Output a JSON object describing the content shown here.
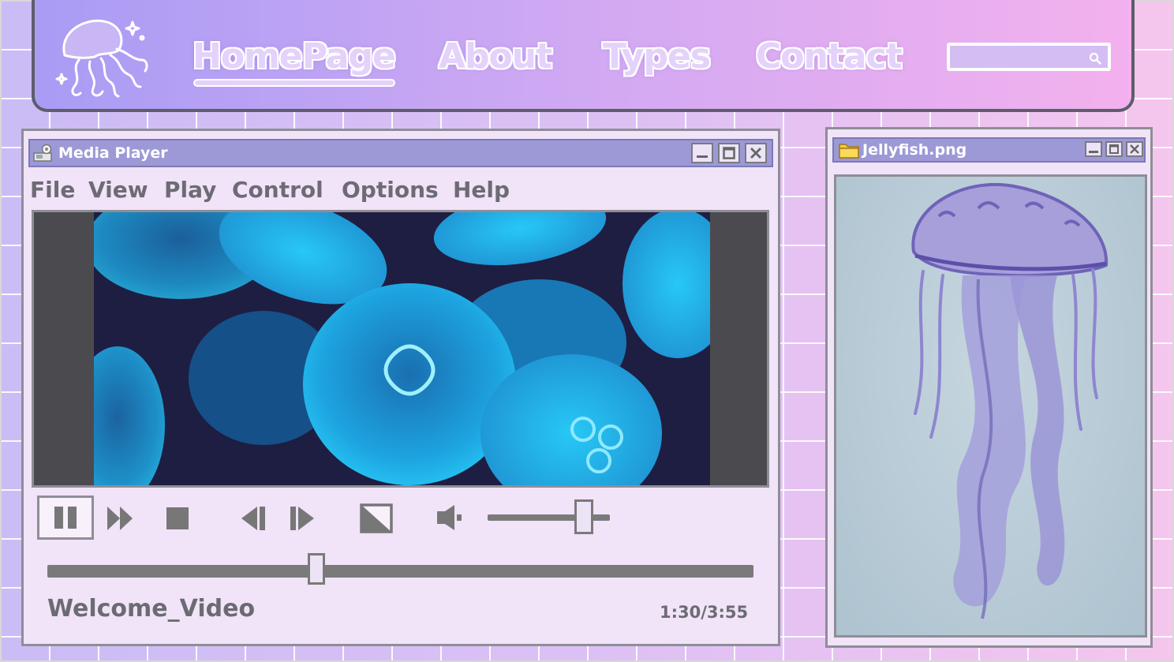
{
  "nav": {
    "links": [
      "HomePage",
      "About",
      "Types",
      "Contact"
    ],
    "active": "HomePage",
    "search_placeholder": "",
    "colors": {
      "bar_start": "#a99cf4",
      "bar_end": "#f3b1ee",
      "link_fill": "#e4d2fb"
    }
  },
  "media_player": {
    "title": "Media Player",
    "menu": [
      "File",
      "View",
      "Play",
      "Control",
      "Options",
      "Help"
    ],
    "video_name": "Welcome_Video",
    "time": "1:30/3:55",
    "progress_fraction": 0.38,
    "volume_fraction": 0.79,
    "controls": [
      "pause-icon",
      "fast-forward-icon",
      "stop-icon",
      "previous-icon",
      "next-icon",
      "fullscreen-icon",
      "volume-icon"
    ]
  },
  "image_viewer": {
    "title": "Jellyfish.png",
    "title_icon": "folder-icon"
  },
  "window_buttons": [
    "minimize-icon",
    "maximize-icon",
    "close-icon"
  ]
}
